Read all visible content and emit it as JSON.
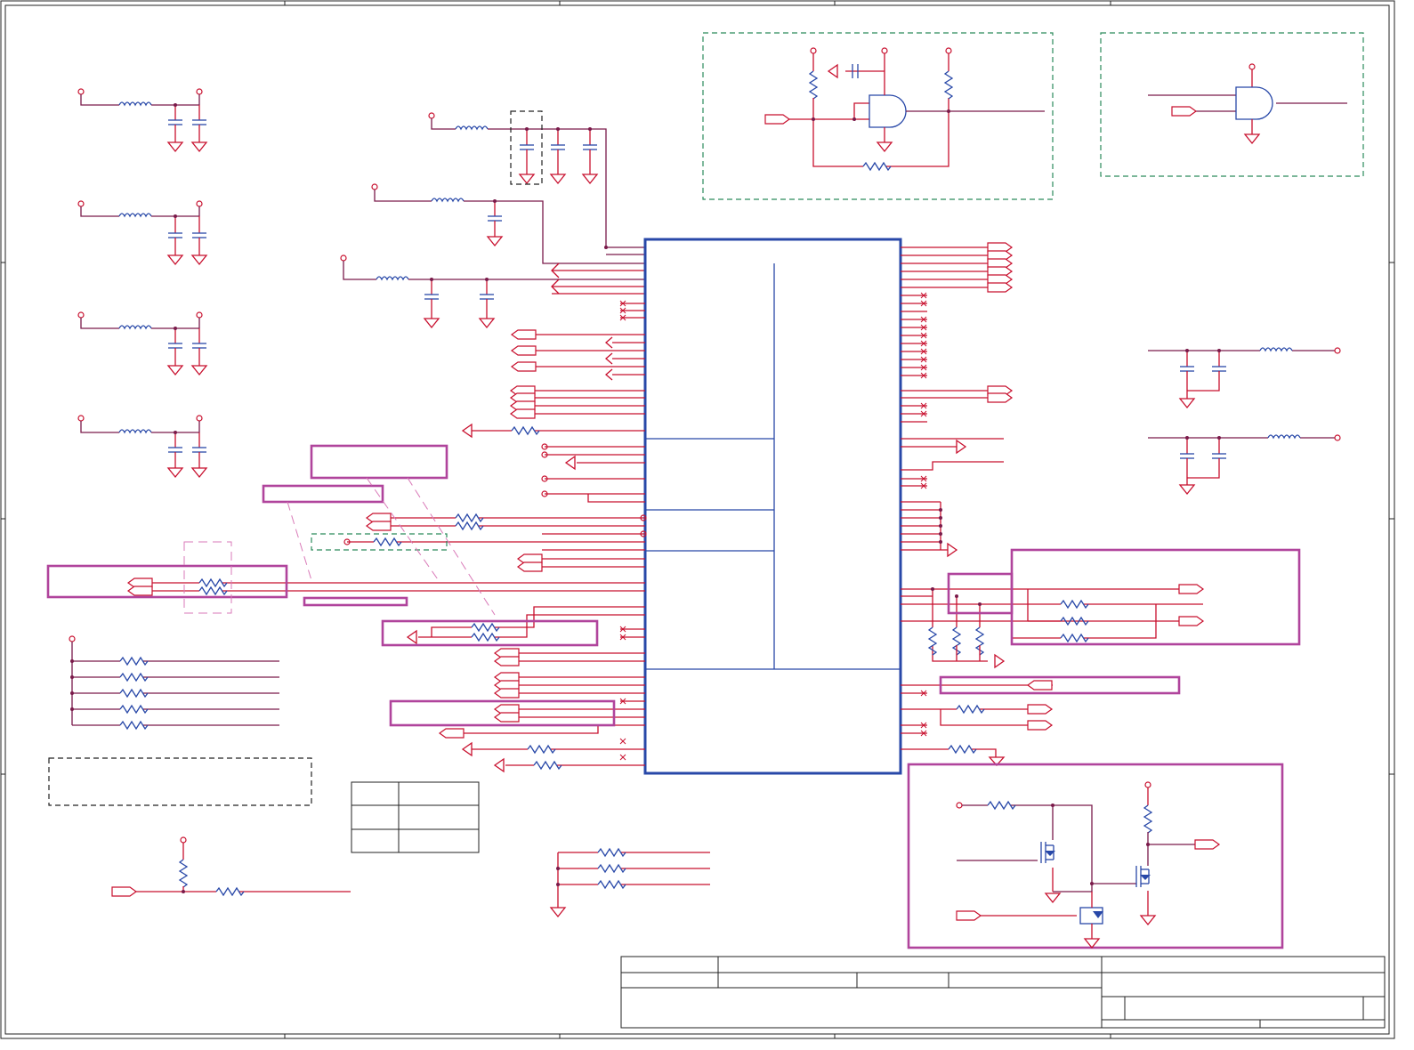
{
  "sheet": {
    "border_color": "#222222",
    "wire_color": "#c8102e",
    "net_color": "#7a1a4a",
    "component_color": "#2848a8",
    "highlight_color": "#b0449c",
    "optional_block_color": "#2a8a5a"
  },
  "title_block": {
    "fields": []
  }
}
